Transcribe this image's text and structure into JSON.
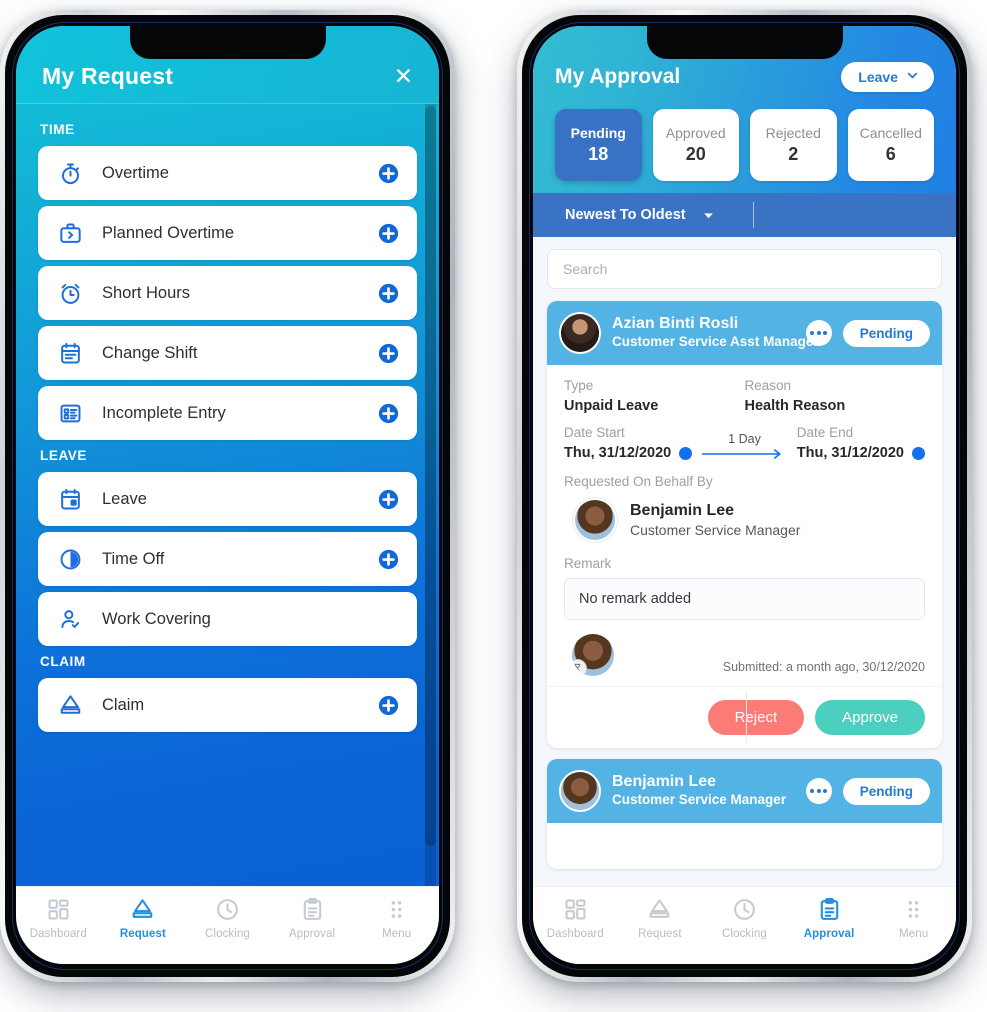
{
  "request_screen": {
    "header": {
      "title": "My Request",
      "close_icon": "close-icon"
    },
    "sections": [
      {
        "label": "TIME",
        "items": [
          {
            "label": "Overtime",
            "icon": "stopwatch-icon",
            "has_add": true
          },
          {
            "label": "Planned Overtime",
            "icon": "briefcase-arrow-icon",
            "has_add": true
          },
          {
            "label": "Short Hours",
            "icon": "alarm-clock-icon",
            "has_add": true
          },
          {
            "label": "Change Shift",
            "icon": "calendar-lines-icon",
            "has_add": true
          },
          {
            "label": "Incomplete Entry",
            "icon": "list-form-icon",
            "has_add": true
          }
        ]
      },
      {
        "label": "LEAVE",
        "items": [
          {
            "label": "Leave",
            "icon": "calendar-day-icon",
            "has_add": true
          },
          {
            "label": "Time Off",
            "icon": "half-clock-icon",
            "has_add": true
          },
          {
            "label": "Work Covering",
            "icon": "user-check-icon",
            "has_add": false
          }
        ]
      },
      {
        "label": "CLAIM",
        "items": [
          {
            "label": "Claim",
            "icon": "claim-tray-icon",
            "has_add": true
          }
        ]
      }
    ],
    "bottom_nav": [
      {
        "label": "Dashboard",
        "icon": "grid-icon",
        "active": false
      },
      {
        "label": "Request",
        "icon": "claim-tray-icon",
        "active": true
      },
      {
        "label": "Clocking",
        "icon": "clock-icon",
        "active": false
      },
      {
        "label": "Approval",
        "icon": "clipboard-icon",
        "active": false
      },
      {
        "label": "Menu",
        "icon": "dots-grid-icon",
        "active": false
      }
    ]
  },
  "approval_screen": {
    "header": {
      "title": "My Approval",
      "filter_label": "Leave",
      "filter_caret_icon": "chevron-down-icon"
    },
    "stats": [
      {
        "label": "Pending",
        "value": "18",
        "active": true
      },
      {
        "label": "Approved",
        "value": "20",
        "active": false
      },
      {
        "label": "Rejected",
        "value": "2",
        "active": false
      },
      {
        "label": "Cancelled",
        "value": "6",
        "active": false
      }
    ],
    "sort": {
      "label": "Newest To Oldest",
      "caret_icon": "caret-down-icon"
    },
    "search": {
      "placeholder": "Search",
      "value": ""
    },
    "cards": [
      {
        "name": "Azian Binti Rosli",
        "role": "Customer Service Asst Manager",
        "status": "Pending",
        "more_icon": "more-dots-icon",
        "type_label": "Type",
        "type_value": "Unpaid Leave",
        "reason_label": "Reason",
        "reason_value": "Health Reason",
        "date_start_label": "Date Start",
        "date_start_value": "Thu, 31/12/2020",
        "date_end_label": "Date End",
        "date_end_value": "Thu, 31/12/2020",
        "duration": "1 Day",
        "behalf_label": "Requested On Behalf By",
        "behalf_name": "Benjamin Lee",
        "behalf_role": "Customer Service Manager",
        "remark_label": "Remark",
        "remark_value": "No remark added",
        "submitted": "Submitted: a month ago, 30/12/2020",
        "reject_label": "Reject",
        "approve_label": "Approve"
      },
      {
        "name": "Benjamin Lee",
        "role": "Customer Service Manager",
        "status": "Pending",
        "more_icon": "more-dots-icon"
      }
    ],
    "bottom_nav": [
      {
        "label": "Dashboard",
        "icon": "grid-icon",
        "active": false
      },
      {
        "label": "Request",
        "icon": "claim-tray-icon",
        "active": false
      },
      {
        "label": "Clocking",
        "icon": "clock-icon",
        "active": false
      },
      {
        "label": "Approval",
        "icon": "clipboard-icon",
        "active": true
      },
      {
        "label": "Menu",
        "icon": "dots-grid-icon",
        "active": false
      }
    ]
  },
  "colors": {
    "teal": "#14c0d8",
    "blue": "#0a5fd2",
    "accent_blue": "#1f8fe8",
    "card_head_blue": "#53b3e4",
    "sort_blue": "#3a72c4",
    "stat_active": "#3872c4",
    "reject": "#fc7b77",
    "approve": "#4ccfbe"
  }
}
